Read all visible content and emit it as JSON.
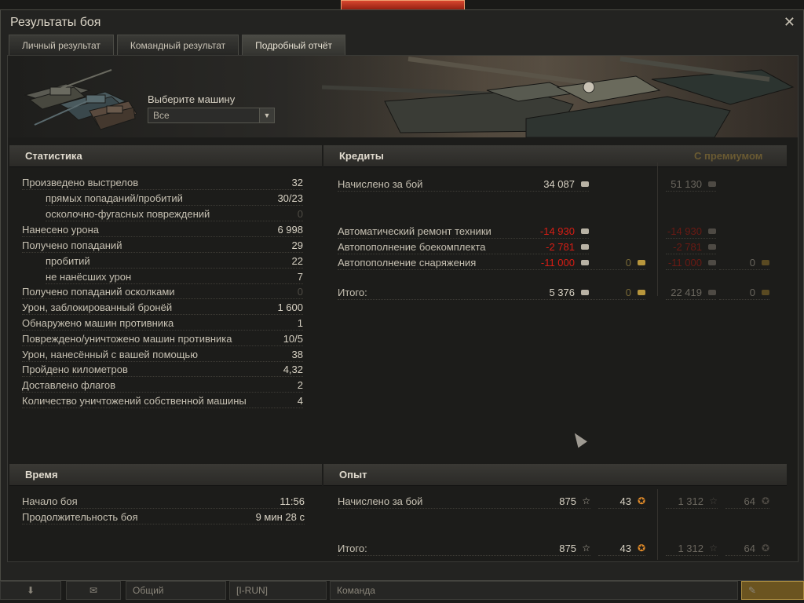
{
  "window": {
    "title": "Результаты боя",
    "close_glyph": "✕"
  },
  "tabs": [
    {
      "label": "Личный результат"
    },
    {
      "label": "Командный результат"
    },
    {
      "label": "Подробный отчёт",
      "active": true
    }
  ],
  "vehicle_select": {
    "label": "Выберите машину",
    "value": "Все",
    "arrow_icon": "chevron-down-icon"
  },
  "statistics": {
    "heading": "Статистика",
    "rows": [
      {
        "label": "Произведено выстрелов",
        "value": "32"
      },
      {
        "label": "прямых попаданий/пробитий",
        "value": "30/23",
        "indent": true
      },
      {
        "label": "осколочно-фугасных повреждений",
        "value": "0",
        "indent": true,
        "dim": true
      },
      {
        "label": "Нанесено урона",
        "value": "6 998"
      },
      {
        "label": "Получено попаданий",
        "value": "29"
      },
      {
        "label": "пробитий",
        "value": "22",
        "indent": true
      },
      {
        "label": "не нанёсших урон",
        "value": "7",
        "indent": true
      },
      {
        "label": "Получено попаданий осколками",
        "value": "0",
        "dim": true
      },
      {
        "label": "Урон, заблокированный бронёй",
        "value": "1 600"
      },
      {
        "label": "Обнаружено машин противника",
        "value": "1"
      },
      {
        "label": "Повреждено/уничтожено машин противника",
        "value": "10/5"
      },
      {
        "label": "Урон, нанесённый с вашей помощью",
        "value": "38"
      },
      {
        "label": "Пройдено километров",
        "value": "4,32"
      },
      {
        "label": "Доставлено флагов",
        "value": "2"
      },
      {
        "label": "Количество уничтожений собственной машины",
        "value": "4"
      }
    ]
  },
  "credits": {
    "heading": "Кредиты",
    "premium_heading": "С премиумом",
    "rows": [
      {
        "label": "Начислено за бой",
        "value": "34 087",
        "gold": "",
        "prem_value": "51 130",
        "prem_gold": ""
      },
      {
        "label": "Автоматический ремонт техники",
        "value": "-14 930",
        "gold": "",
        "prem_value": "-14 930",
        "prem_gold": "",
        "negative": true
      },
      {
        "label": "Автопополнение боекомплекта",
        "value": "-2 781",
        "gold": "",
        "prem_value": "-2 781",
        "prem_gold": "",
        "negative": true
      },
      {
        "label": "Автопополнение снаряжения",
        "value": "-11 000",
        "gold": "0",
        "prem_value": "-11 000",
        "prem_gold": "0",
        "negative": true
      },
      {
        "label": "Итого:",
        "value": "5 376",
        "gold": "0",
        "prem_value": "22 419",
        "prem_gold": "0"
      }
    ]
  },
  "time": {
    "heading": "Время",
    "rows": [
      {
        "label": "Начало боя",
        "value": "11:56"
      },
      {
        "label": "Продолжительность боя",
        "value": "9 мин 28 с"
      }
    ]
  },
  "experience": {
    "heading": "Опыт",
    "rows": [
      {
        "label": "Начислено за бой",
        "value": "875",
        "free": "43",
        "prem_value": "1 312",
        "prem_free": "64"
      },
      {
        "label": "Итого:",
        "value": "875",
        "free": "43",
        "prem_value": "1 312",
        "prem_free": "64"
      }
    ]
  },
  "bottom_bar": {
    "left_glyph": "⬇",
    "chat_glyph": "✉",
    "field_general": "Общий",
    "field_clan": "[I-RUN]",
    "field_team": "Команда",
    "right_glyph": "✎"
  },
  "colors": {
    "negative": "#d81d14",
    "premium_heading": "#6a5a32",
    "accent_red": "#c8351e",
    "experience_star": "#e08a28"
  }
}
